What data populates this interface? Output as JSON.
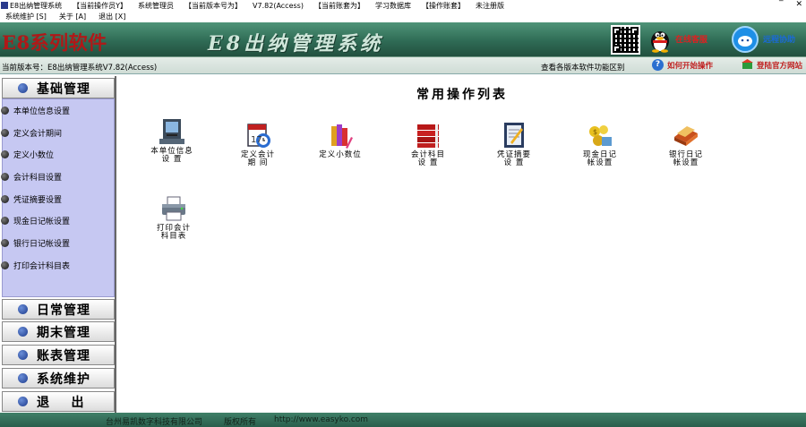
{
  "titlebar": {
    "segments": [
      "E8出纳管理系统",
      "【当前操作员Y】",
      "系统管理员",
      "【当前版本号为】",
      "V7.82(Access)",
      "【当前账套为】",
      "学习数据库",
      "【操作账套】",
      "未注册版"
    ],
    "minimize": "‾",
    "close": "✕"
  },
  "menu": {
    "items": [
      "系统维护 [S]",
      "关于 [A]",
      "退出 [X]"
    ]
  },
  "banner": {
    "brand": "E8系列软件",
    "system_name": "E8出纳管理系统",
    "online_help": "在线客服",
    "remote_help": "远程协助"
  },
  "infobar": {
    "version": "当前版本号：E8出纳管理系统V7.82(Access)",
    "diff_link": "查看各版本软件功能区别",
    "howto": "如何开始操作",
    "official": "登陆官方网站"
  },
  "sidebar": {
    "sections": [
      "基础管理",
      "日常管理",
      "期末管理",
      "账表管理",
      "系统维护",
      "退    出"
    ],
    "items": [
      "本单位信息设置",
      "定义会计期间",
      "定义小数位",
      "会计科目设置",
      "凭证摘要设置",
      "现金日记帐设置",
      "银行日记帐设置",
      "打印会计科目表"
    ]
  },
  "main": {
    "heading": "常用操作列表",
    "tiles": [
      {
        "line1": "本单位信息",
        "line2": "设 置",
        "icon": "terminal-icon"
      },
      {
        "line1": "定义会计",
        "line2": "期 间",
        "icon": "calendar-icon"
      },
      {
        "line1": "定义小数位",
        "line2": "",
        "icon": "books-icon"
      },
      {
        "line1": "会计科目",
        "line2": "设 置",
        "icon": "ledger-icon"
      },
      {
        "line1": "凭证摘要",
        "line2": "设 置",
        "icon": "notepad-icon"
      },
      {
        "line1": "现金日记",
        "line2": "帐设置",
        "icon": "cash-icon"
      },
      {
        "line1": "银行日记",
        "line2": "帐设置",
        "icon": "bank-book-icon"
      },
      {
        "line1": "打印会计",
        "line2": "科目表",
        "icon": "printer-icon"
      }
    ]
  },
  "statusbar": {
    "company": "台州易凯数字科技有限公司",
    "rights": "版权所有",
    "url": "http://www.easyko.com"
  }
}
